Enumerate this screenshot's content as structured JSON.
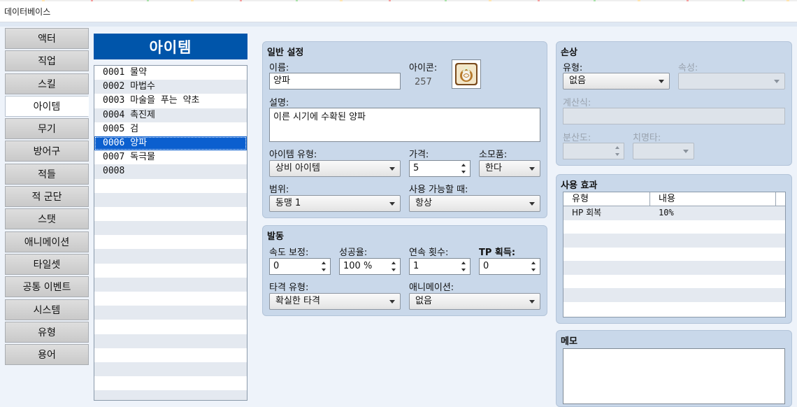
{
  "window": {
    "title": "데이터베이스"
  },
  "categories": [
    "액터",
    "직업",
    "스킬",
    "아이템",
    "무기",
    "방어구",
    "적들",
    "적 군단",
    "스탯",
    "애니메이션",
    "타일셋",
    "공통 이벤트",
    "시스템",
    "유형",
    "용어"
  ],
  "active_category": 3,
  "list": {
    "title": "아이템",
    "items": [
      "0001 물약",
      "0002 마법수",
      "0003 마술을 푸는 약초",
      "0004 촉진제",
      "0005 검",
      "0006 양파",
      "0007 독극물",
      "0008"
    ],
    "selected": 5
  },
  "general": {
    "title": "일반 설정",
    "name_label": "이름:",
    "name_value": "양파",
    "icon_label": "아이콘:",
    "icon_index": "257",
    "desc_label": "설명:",
    "desc_value": "이른 시기에 수확된 양파",
    "item_type_label": "아이템 유형:",
    "item_type_value": "상비 아이템",
    "price_label": "가격:",
    "price_value": "5",
    "consumable_label": "소모품:",
    "consumable_value": "한다",
    "scope_label": "범위:",
    "scope_value": "동맹 1",
    "occasion_label": "사용 가능할 때:",
    "occasion_value": "항상"
  },
  "invocation": {
    "title": "발동",
    "speed_label": "속도 보정:",
    "speed_value": "0",
    "success_label": "성공율:",
    "success_value": "100 %",
    "repeat_label": "연속 횟수:",
    "repeat_value": "1",
    "tp_label": "TP 획득:",
    "tp_value": "0",
    "hit_type_label": "타격 유형:",
    "hit_type_value": "확실한 타격",
    "animation_label": "애니메이션:",
    "animation_value": "없음"
  },
  "damage": {
    "title": "손상",
    "type_label": "유형:",
    "type_value": "없음",
    "element_label": "속성:",
    "formula_label": "계산식:",
    "variance_label": "분산도:",
    "critical_label": "치명타:"
  },
  "effects": {
    "title": "사용 효과",
    "col_type": "유형",
    "col_content": "내용",
    "rows": [
      {
        "type": "HP 회복",
        "content": "10%"
      }
    ]
  },
  "memo": {
    "title": "메모"
  },
  "colors": {
    "list_header": "#0055aa",
    "selection": "#0b5fcf",
    "panel": "#c9d8ea"
  }
}
